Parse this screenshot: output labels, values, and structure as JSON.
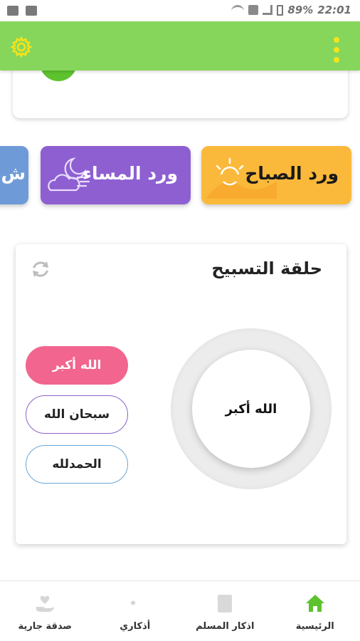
{
  "status_bar": {
    "battery": "89%",
    "time": "22:01"
  },
  "app_bar": {
    "settings_icon": "gear-icon",
    "menu_icon": "kebab-menu-icon",
    "background": "#86d65c",
    "menu_color": "#f5e41a"
  },
  "wird_cards": [
    {
      "label": "ورد الصباح",
      "color": "#fbb93b",
      "icon": "sunrise-icon"
    },
    {
      "label": "ورد المساء",
      "color": "#8e5fd1",
      "icon": "night-cloud-moon-icon"
    },
    {
      "label": "ش",
      "color": "#6e9bd8"
    }
  ],
  "tasbih": {
    "title": "حلقة التسبيح",
    "refresh_icon": "refresh-icon",
    "counter_text": "الله أكبر",
    "buttons": [
      {
        "label": "الله أكبر",
        "color": "#f1658f"
      },
      {
        "label": "سبحان الله",
        "border": "#8c63c7"
      },
      {
        "label": "الحمدلله",
        "border": "#6aa6d6"
      }
    ]
  },
  "bottom_nav": [
    {
      "label": "الرئيسية",
      "icon": "home-icon",
      "active": true,
      "color": "#5cc32e"
    },
    {
      "label": "اذكار المسلم",
      "icon": "book-icon"
    },
    {
      "label": "أذكاري",
      "icon": "crescent-star-icon"
    },
    {
      "label": "صدقة جارية",
      "icon": "heart-hand-icon"
    }
  ]
}
